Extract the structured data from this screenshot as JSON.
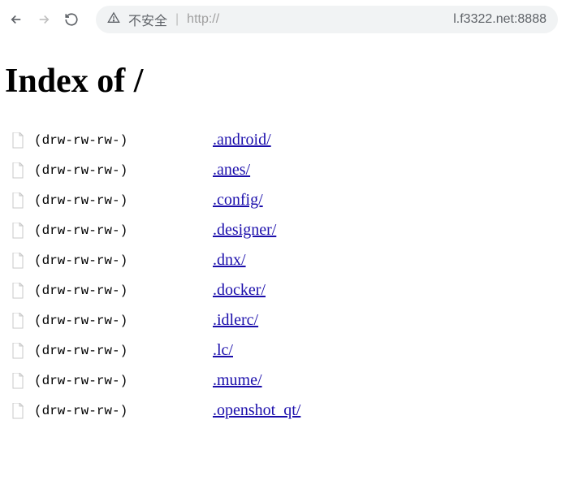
{
  "toolbar": {
    "security_label": "不安全",
    "url_protocol": "http://",
    "url_host": "l.f3322.net:8888"
  },
  "page": {
    "title": "Index of /"
  },
  "listing": [
    {
      "perms": "(drw-rw-rw-)",
      "name": ".android/"
    },
    {
      "perms": "(drw-rw-rw-)",
      "name": ".anes/"
    },
    {
      "perms": "(drw-rw-rw-)",
      "name": ".config/"
    },
    {
      "perms": "(drw-rw-rw-)",
      "name": ".designer/"
    },
    {
      "perms": "(drw-rw-rw-)",
      "name": ".dnx/"
    },
    {
      "perms": "(drw-rw-rw-)",
      "name": ".docker/"
    },
    {
      "perms": "(drw-rw-rw-)",
      "name": ".idlerc/"
    },
    {
      "perms": "(drw-rw-rw-)",
      "name": ".lc/"
    },
    {
      "perms": "(drw-rw-rw-)",
      "name": ".mume/"
    },
    {
      "perms": "(drw-rw-rw-)",
      "name": ".openshot_qt/"
    }
  ]
}
